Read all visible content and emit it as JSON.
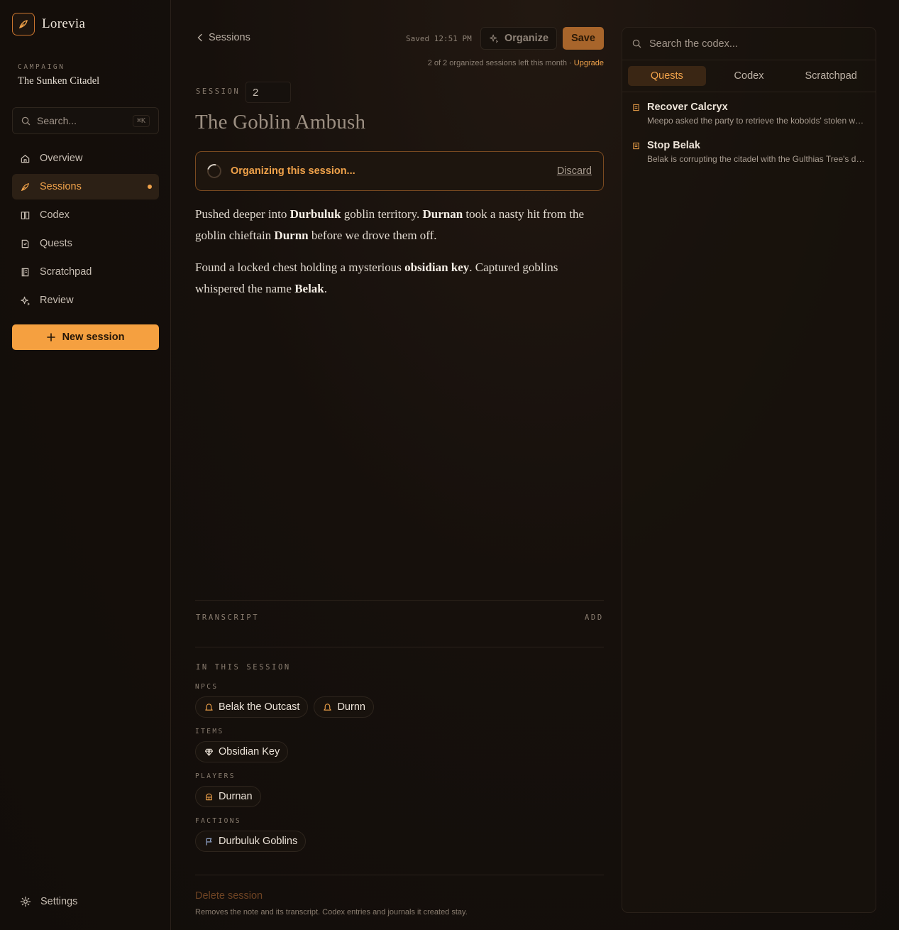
{
  "app": {
    "name": "Lorevia"
  },
  "campaign": {
    "label": "CAMPAIGN",
    "name": "The Sunken Citadel"
  },
  "sidebar": {
    "search_placeholder": "Search...",
    "shortcut": "⌘K",
    "items": [
      {
        "label": "Overview",
        "icon": "home-icon"
      },
      {
        "label": "Sessions",
        "icon": "quill-icon",
        "active": true
      },
      {
        "label": "Codex",
        "icon": "book-icon"
      },
      {
        "label": "Quests",
        "icon": "scroll-icon"
      },
      {
        "label": "Scratchpad",
        "icon": "notebook-icon"
      },
      {
        "label": "Review",
        "icon": "sparkle-icon"
      }
    ],
    "new_session_label": "New session",
    "settings_label": "Settings"
  },
  "header": {
    "back_label": "Sessions",
    "saved_text": "Saved 12:51 PM",
    "organize_label": "Organize",
    "save_label": "Save",
    "quota_text": "2 of 2 organized sessions left this month · ",
    "upgrade_label": "Upgrade"
  },
  "session": {
    "label": "SESSION",
    "number": "2",
    "title": "The Goblin Ambush",
    "organizing_text": "Organizing this session...",
    "discard_label": "Discard"
  },
  "notes": {
    "p1": [
      {
        "t": "Pushed deeper into ",
        "b": false
      },
      {
        "t": "Durbuluk",
        "b": true
      },
      {
        "t": " goblin territory. ",
        "b": false
      },
      {
        "t": "Durnan",
        "b": true
      },
      {
        "t": " took a nasty hit from the goblin chieftain ",
        "b": false
      },
      {
        "t": "Durnn",
        "b": true
      },
      {
        "t": " before we drove them off.",
        "b": false
      }
    ],
    "p2": [
      {
        "t": "Found a locked chest holding a mysterious ",
        "b": false
      },
      {
        "t": "obsidian key",
        "b": true
      },
      {
        "t": ". Captured goblins whispered the name ",
        "b": false
      },
      {
        "t": "Belak",
        "b": true
      },
      {
        "t": ".",
        "b": false
      }
    ]
  },
  "transcript": {
    "label": "TRANSCRIPT",
    "add_label": "ADD"
  },
  "in_session": {
    "label": "IN THIS SESSION",
    "npcs_label": "NPCS",
    "npcs": [
      "Belak the Outcast",
      "Durnn"
    ],
    "items_label": "ITEMS",
    "items": [
      "Obsidian Key"
    ],
    "players_label": "PLAYERS",
    "players": [
      "Durnan"
    ],
    "factions_label": "FACTIONS",
    "factions": [
      "Durbuluk Goblins"
    ]
  },
  "danger": {
    "delete_label": "Delete session",
    "delete_desc": "Removes the note and its transcript. Codex entries and journals it created stay."
  },
  "panel": {
    "search_placeholder": "Search the codex...",
    "tabs": [
      "Quests",
      "Codex",
      "Scratchpad"
    ],
    "active_tab": "Quests",
    "quests": [
      {
        "title": "Recover Calcryx",
        "desc": "Meepo asked the party to retrieve the kobolds' stolen white dragon wyrmling."
      },
      {
        "title": "Stop Belak",
        "desc": "Belak is corrupting the citadel with the Gulthias Tree's dark power."
      }
    ]
  },
  "colors": {
    "accent": "#f0a24a",
    "background": "#140f0b",
    "border": "#2a211a"
  }
}
